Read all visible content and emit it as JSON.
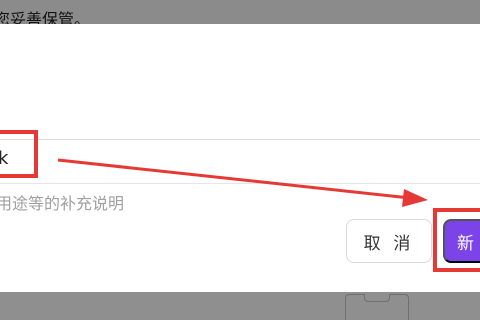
{
  "top_text": "您妥善保管。",
  "name_input": {
    "value": "k"
  },
  "hint": "用途等的补充说明",
  "buttons": {
    "cancel": "取 消",
    "new": "新"
  },
  "colors": {
    "annotation": "#e53935",
    "primary": "#7c44e8"
  }
}
